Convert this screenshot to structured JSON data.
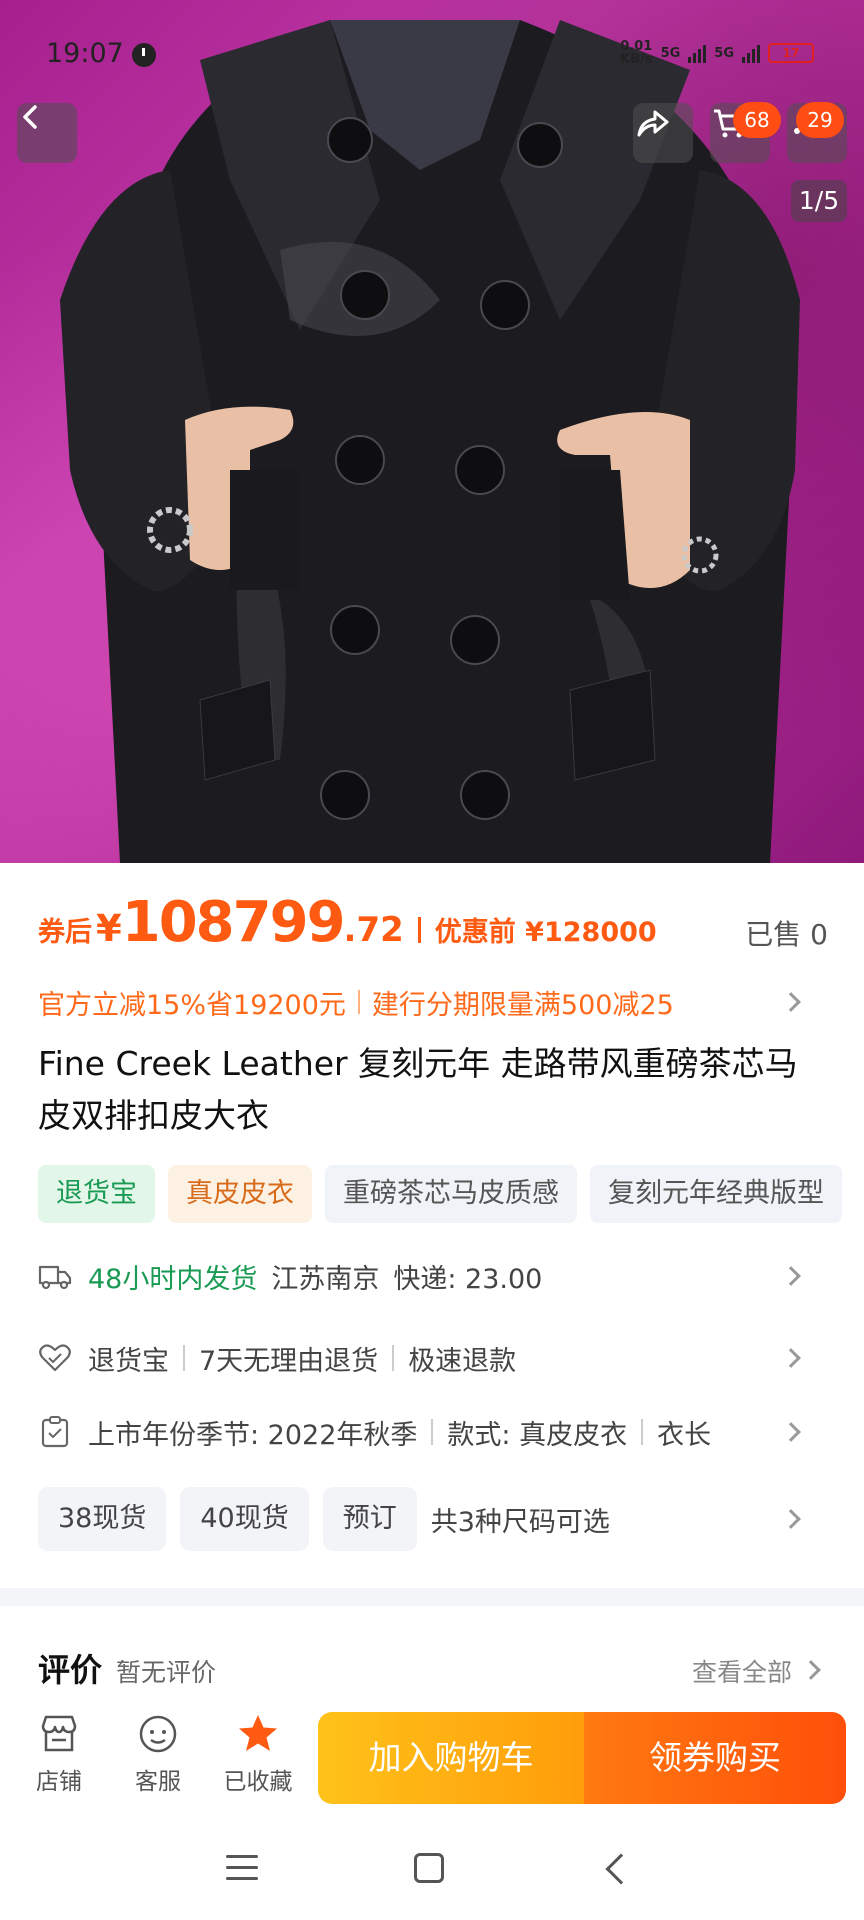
{
  "status_bar": {
    "time": "19:07",
    "net_speed_top": "0.01",
    "net_speed_bottom": "KB/s",
    "signal1": "5G",
    "signal2": "5G",
    "battery": "17"
  },
  "image_controls": {
    "cart_badge": "68",
    "more_badge": "29",
    "pager": "1/5"
  },
  "price": {
    "prefix": "券后",
    "yen": "¥",
    "integer": "108799",
    "decimal": ".72",
    "original": "优惠前 ¥128000",
    "sold": "已售 0"
  },
  "promo": {
    "discount": "官方立减15%省19200元",
    "installment": "建行分期限量满500减25"
  },
  "product_title": "Fine Creek Leather 复刻元年 走路带风重磅茶芯马皮双排扣皮大衣",
  "tags": [
    {
      "label": "退货宝"
    },
    {
      "label": "真皮皮衣"
    },
    {
      "label": "重磅茶芯马皮质感"
    },
    {
      "label": "复刻元年经典版型"
    }
  ],
  "shipping": {
    "time": "48小时内发货",
    "location": "江苏南京",
    "fee": "快递: 23.00"
  },
  "returns": {
    "service": "退货宝",
    "policy": "7天无理由退货",
    "refund": "极速退款"
  },
  "params": {
    "season": "上市年份季节: 2022年秋季",
    "style": "款式: 真皮皮衣",
    "length": "衣长"
  },
  "sizes": {
    "options": [
      "38现货",
      "40现货",
      "预订"
    ],
    "summary": "共3种尺码可选"
  },
  "review": {
    "title": "评价",
    "status": "暂无评价",
    "view_all": "查看全部"
  },
  "action_bar": {
    "shop": "店铺",
    "service": "客服",
    "favorite": "已收藏",
    "add_to_cart": "加入购物车",
    "buy_now": "领券购买"
  },
  "colors": {
    "accent": "#ff5a12",
    "green": "#1a9b53",
    "cart_button": "#ffb014",
    "buy_button": "#ff5a0a"
  },
  "icons": [
    "back-icon",
    "share-icon",
    "cart-icon",
    "more-icon",
    "truck-icon",
    "heart-shield-icon",
    "clipboard-icon",
    "shop-icon",
    "service-icon",
    "star-icon"
  ]
}
